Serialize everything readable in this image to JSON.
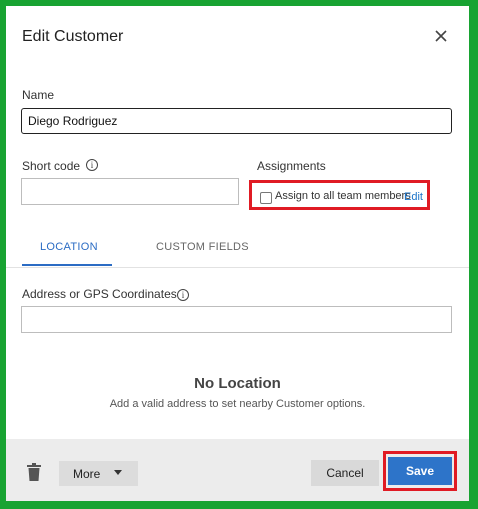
{
  "dialog": {
    "title": "Edit Customer",
    "close_icon": "close-icon"
  },
  "form": {
    "name_label": "Name",
    "name_value": "Diego Rodriguez",
    "short_code_label": "Short code",
    "short_code_value": "",
    "assignments_label": "Assignments",
    "assign_all_label": "Assign to all team members",
    "assign_all_checked": false,
    "edit_link": "Edit"
  },
  "tabs": [
    {
      "label": "LOCATION",
      "active": true
    },
    {
      "label": "CUSTOM FIELDS",
      "active": false
    }
  ],
  "location": {
    "address_label": "Address or GPS Coordinates",
    "address_value": "",
    "empty_title": "No Location",
    "empty_subtitle": "Add a valid address to set nearby Customer options."
  },
  "footer": {
    "more_label": "More",
    "cancel_label": "Cancel",
    "save_label": "Save"
  },
  "colors": {
    "accent": "#2d74c9",
    "highlight": "#e01b24",
    "frame": "#18a332"
  }
}
